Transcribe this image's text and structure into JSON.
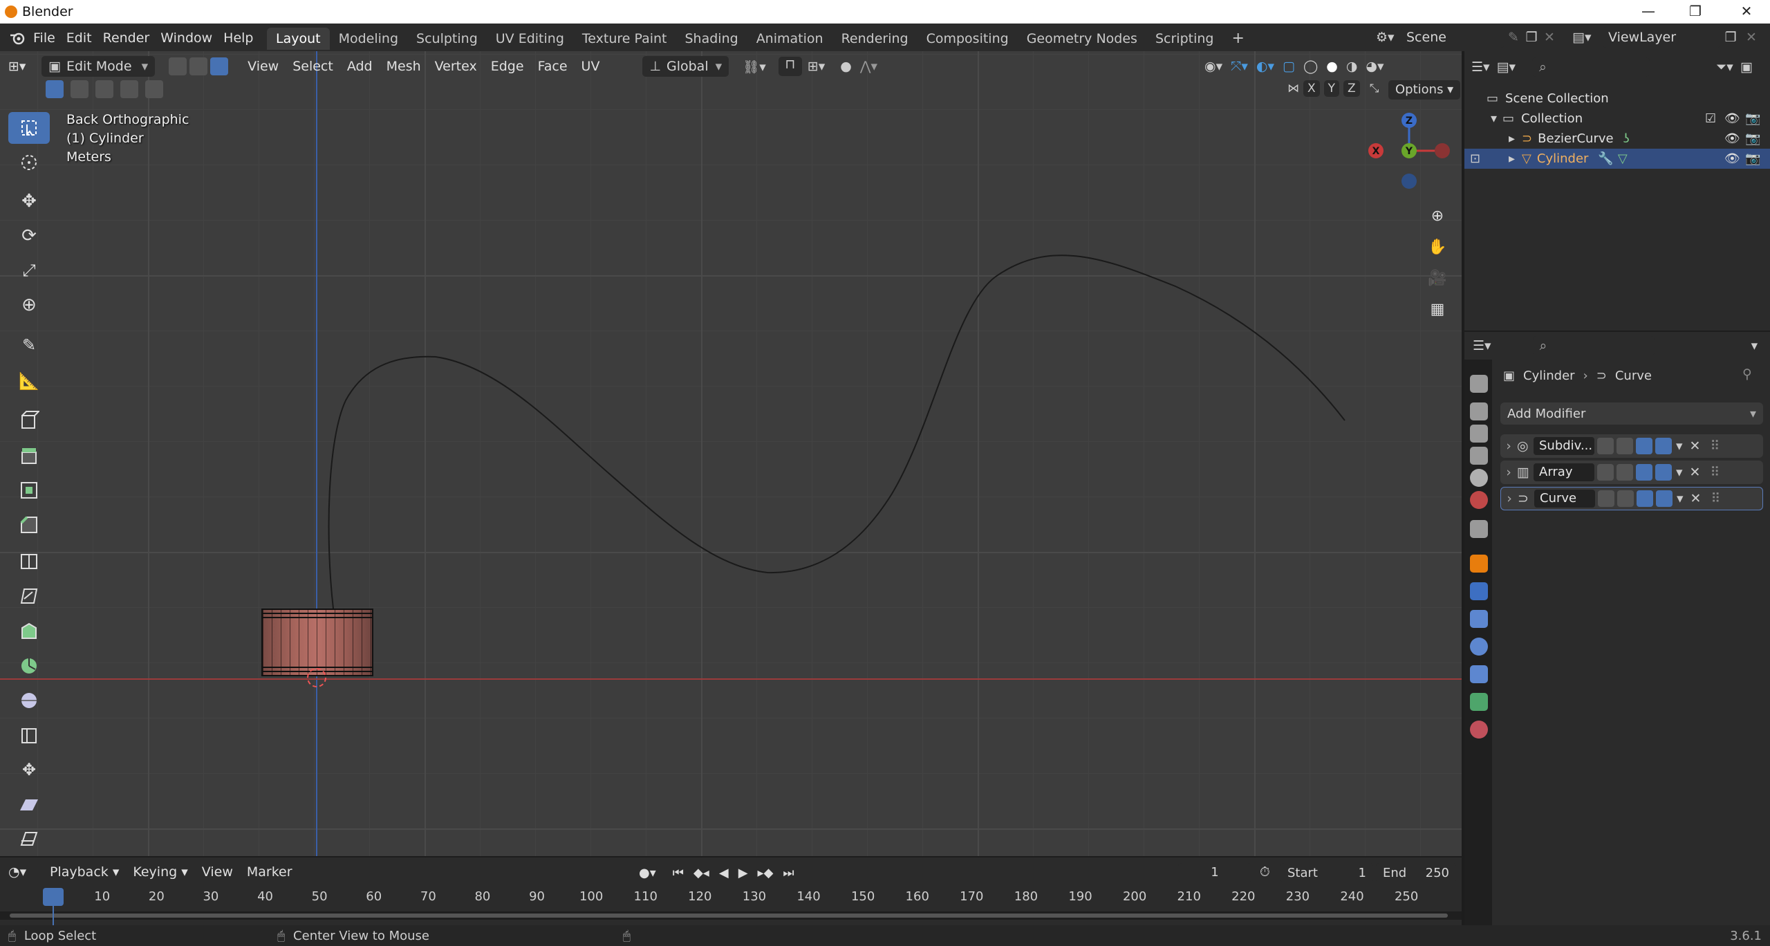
{
  "window": {
    "title": "Blender",
    "version": "3.6.1"
  },
  "menu": [
    "File",
    "Edit",
    "Render",
    "Window",
    "Help"
  ],
  "workspaces": [
    "Layout",
    "Modeling",
    "Sculpting",
    "UV Editing",
    "Texture Paint",
    "Shading",
    "Animation",
    "Rendering",
    "Compositing",
    "Geometry Nodes",
    "Scripting"
  ],
  "active_workspace": "Layout",
  "scene": {
    "name": "Scene",
    "view_layer": "ViewLayer"
  },
  "viewport_header": {
    "mode": "Edit Mode",
    "menus": [
      "View",
      "Select",
      "Add",
      "Mesh",
      "Vertex",
      "Edge",
      "Face",
      "UV"
    ],
    "orientation": "Global",
    "options_label": "Options",
    "axes": [
      "X",
      "Y",
      "Z"
    ]
  },
  "viewport_info": {
    "view": "Back Orthographic",
    "object": "(1) Cylinder",
    "units": "Meters"
  },
  "gizmo": {
    "z": "Z",
    "y": "Y",
    "x": "X"
  },
  "outliner": {
    "root": "Scene Collection",
    "collection": "Collection",
    "items": [
      {
        "name": "BezierCurve",
        "selected": false
      },
      {
        "name": "Cylinder",
        "selected": true
      }
    ]
  },
  "properties": {
    "breadcrumb_object": "Cylinder",
    "breadcrumb_modifier": "Curve",
    "add_modifier_label": "Add Modifier",
    "modifiers": [
      "Subdiv...",
      "Array",
      "Curve"
    ]
  },
  "timeline": {
    "menus": [
      "Playback",
      "Keying",
      "View",
      "Marker"
    ],
    "current_frame": "1",
    "start_label": "Start",
    "start_value": "1",
    "end_label": "End",
    "end_value": "250",
    "ruler": [
      "1",
      "10",
      "20",
      "30",
      "40",
      "50",
      "60",
      "70",
      "80",
      "90",
      "100",
      "110",
      "120",
      "130",
      "140",
      "150",
      "160",
      "170",
      "180",
      "190",
      "200",
      "210",
      "220",
      "230",
      "240",
      "250"
    ]
  },
  "statusbar": {
    "left": "Loop Select",
    "middle": "Center View to Mouse"
  },
  "colors": {
    "accent": "#4772b3",
    "orange": "#e87d0d",
    "x_axis": "#c83a3a",
    "y_axis": "#6aa62a",
    "z_axis": "#3a6cc8"
  }
}
